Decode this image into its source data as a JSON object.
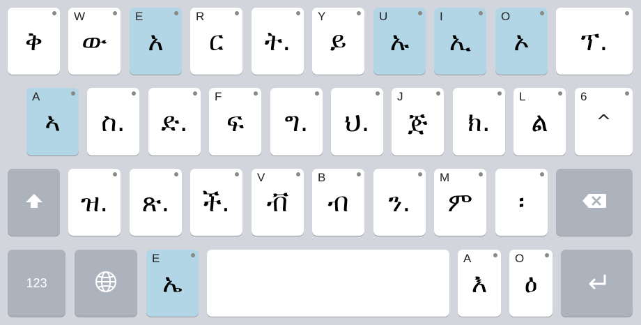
{
  "keyboard": {
    "row1": [
      {
        "glyph": "ቅ",
        "hint": ""
      },
      {
        "glyph": "ው",
        "hint": "W"
      },
      {
        "glyph": "አ",
        "hint": "E"
      },
      {
        "glyph": "ር",
        "hint": "R"
      },
      {
        "glyph": "ት.",
        "hint": ""
      },
      {
        "glyph": "ይ",
        "hint": "Y"
      },
      {
        "glyph": "ኡ",
        "hint": "U"
      },
      {
        "glyph": "ኢ",
        "hint": "I"
      },
      {
        "glyph": "ኦ",
        "hint": "O"
      },
      {
        "glyph": "ፕ.",
        "hint": ""
      }
    ],
    "row2": [
      {
        "glyph": "ኣ",
        "hint": "A"
      },
      {
        "glyph": "ስ.",
        "hint": ""
      },
      {
        "glyph": "ድ.",
        "hint": ""
      },
      {
        "glyph": "ፍ",
        "hint": "F"
      },
      {
        "glyph": "ግ.",
        "hint": ""
      },
      {
        "glyph": "ህ.",
        "hint": ""
      },
      {
        "glyph": "ጅ",
        "hint": "J"
      },
      {
        "glyph": "ክ.",
        "hint": ""
      },
      {
        "glyph": "ል",
        "hint": "L"
      },
      {
        "glyph": "^",
        "hint": "6"
      }
    ],
    "row3": [
      {
        "glyph": "ዝ.",
        "hint": ""
      },
      {
        "glyph": "ጽ.",
        "hint": ""
      },
      {
        "glyph": "ች.",
        "hint": ""
      },
      {
        "glyph": "ቭ",
        "hint": "V"
      },
      {
        "glyph": "ብ",
        "hint": "B"
      },
      {
        "glyph": "ን.",
        "hint": ""
      },
      {
        "glyph": "ም",
        "hint": "M"
      },
      {
        "glyph": "፡",
        "hint": ""
      }
    ],
    "row4": {
      "numbers_label": "123",
      "e_key": {
        "glyph": "ኤ",
        "hint": "E"
      },
      "a_key": {
        "glyph": "እ",
        "hint": "A"
      },
      "o_key": {
        "glyph": "ዕ",
        "hint": "O"
      }
    },
    "icons": {
      "shift": "shift-arrow-icon",
      "backspace": "backspace-icon",
      "globe": "globe-icon",
      "return": "return-arrow-icon"
    },
    "colors": {
      "background": "#d2d5dc",
      "key": "#ffffff",
      "vowel_key": "#b3d6e6",
      "function_key": "#adb3bd"
    }
  }
}
